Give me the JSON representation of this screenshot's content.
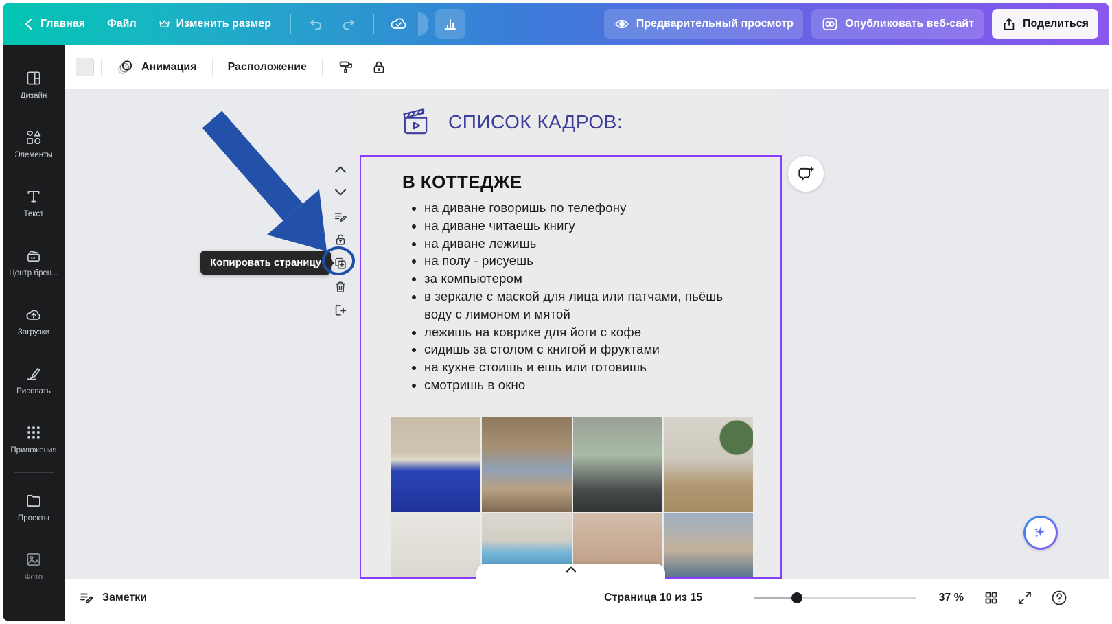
{
  "topbar": {
    "home": "Главная",
    "file": "Файл",
    "resize": "Изменить размер",
    "preview": "Предварительный просмотр",
    "publish": "Опубликовать веб-сайт",
    "share": "Поделиться"
  },
  "sidebar": {
    "items": [
      {
        "label": "Дизайн",
        "icon": "design-icon"
      },
      {
        "label": "Элементы",
        "icon": "elements-icon"
      },
      {
        "label": "Текст",
        "icon": "text-icon"
      },
      {
        "label": "Центр брен...",
        "icon": "brand-center-icon"
      },
      {
        "label": "Загрузки",
        "icon": "uploads-icon"
      },
      {
        "label": "Рисовать",
        "icon": "draw-icon"
      },
      {
        "label": "Приложения",
        "icon": "apps-icon"
      },
      {
        "label": "Проекты",
        "icon": "projects-icon"
      },
      {
        "label": "Фото",
        "icon": "photos-icon"
      }
    ]
  },
  "toolbar": {
    "animation": "Анимация",
    "position": "Расположение"
  },
  "doc": {
    "header_title": "СПИСОК КАДРОВ:",
    "section_title": "В КОТТЕДЖЕ",
    "bullets": [
      "на диване говоришь по телефону",
      "на диване читаешь книгу",
      "на диване лежишь",
      "на полу - рисуешь",
      "за компьютером",
      "в зеркале с маской для лица или патчами, пьёшь воду с лимоном и мятой",
      "лежишь на коврике для йоги с кофе",
      "сидишь за столом с книгой и фруктами",
      "на кухне стоишь и ешь или готовишь",
      "смотришь в окно"
    ]
  },
  "tooltip": {
    "copy_page": "Копировать страницу"
  },
  "bottombar": {
    "notes": "Заметки",
    "page_indicator": "Страница 10 из 15",
    "zoom_percent": "37 %"
  },
  "colors": {
    "selection_purple": "#8b3dff",
    "annotation_blue": "#2350a8",
    "ring_blue": "#1d4ea8",
    "title_indigo": "#3b3e9a",
    "topbar_gradient": [
      "#00c5b2",
      "#3b7cd9",
      "#8957ef"
    ]
  },
  "photos": [
    {
      "name": "girl-on-blue-sofa-phone",
      "bg": "linear-gradient(180deg,#c8bca8 0%,#cfc4b0 38%,#dfd9c8 45%,#2a44b5 57%,#20339b 100%)"
    },
    {
      "name": "legs-up-on-couch",
      "bg": "linear-gradient(180deg,#8f7a60 0%,#a78f72 32%,#90a0b5 55%,#b9a183 76%,#7e6a52 100%)"
    },
    {
      "name": "eating-on-dark-sofa",
      "bg": "linear-gradient(180deg,#9aa095 0%,#a8bba6 40%,#46494a 78%,#333637 100%)"
    },
    {
      "name": "drawing-on-floor",
      "bg": "radial-gradient(circle at 82% 22%,#54744a 0 16%,rgba(0,0,0,0) 17%),linear-gradient(180deg,#d9d4ca 0%,#cdc8bc 45%,#b29873 72%,#a68d63 100%)"
    },
    {
      "name": "laptop-and-salad-on-sofa",
      "bg": "linear-gradient(180deg,#e9e7e2 0%,#dddad3 55%,#d2cfc7 100%)"
    },
    {
      "name": "kitchen-window-plants",
      "bg": "linear-gradient(180deg,#ddd8cf 0%,#d3cec4 28%,#6fb3d6 42%,#589bc2 58%,#cfc9bd 72%,#c4beb1 100%)"
    },
    {
      "name": "drinking-water-face-mask",
      "bg": "linear-gradient(180deg,#d3bdaa 0%,#c4a68f 45%,#97765f 100%)"
    },
    {
      "name": "table-with-fruits",
      "bg": "radial-gradient(circle at 62% 88%,#d6be56 0 14%,rgba(0,0,0,0) 15%),linear-gradient(180deg,#9fb0c4 0%,#c2b29b 38%,#4d6d8d 70%,#3c5a78 100%)"
    }
  ]
}
